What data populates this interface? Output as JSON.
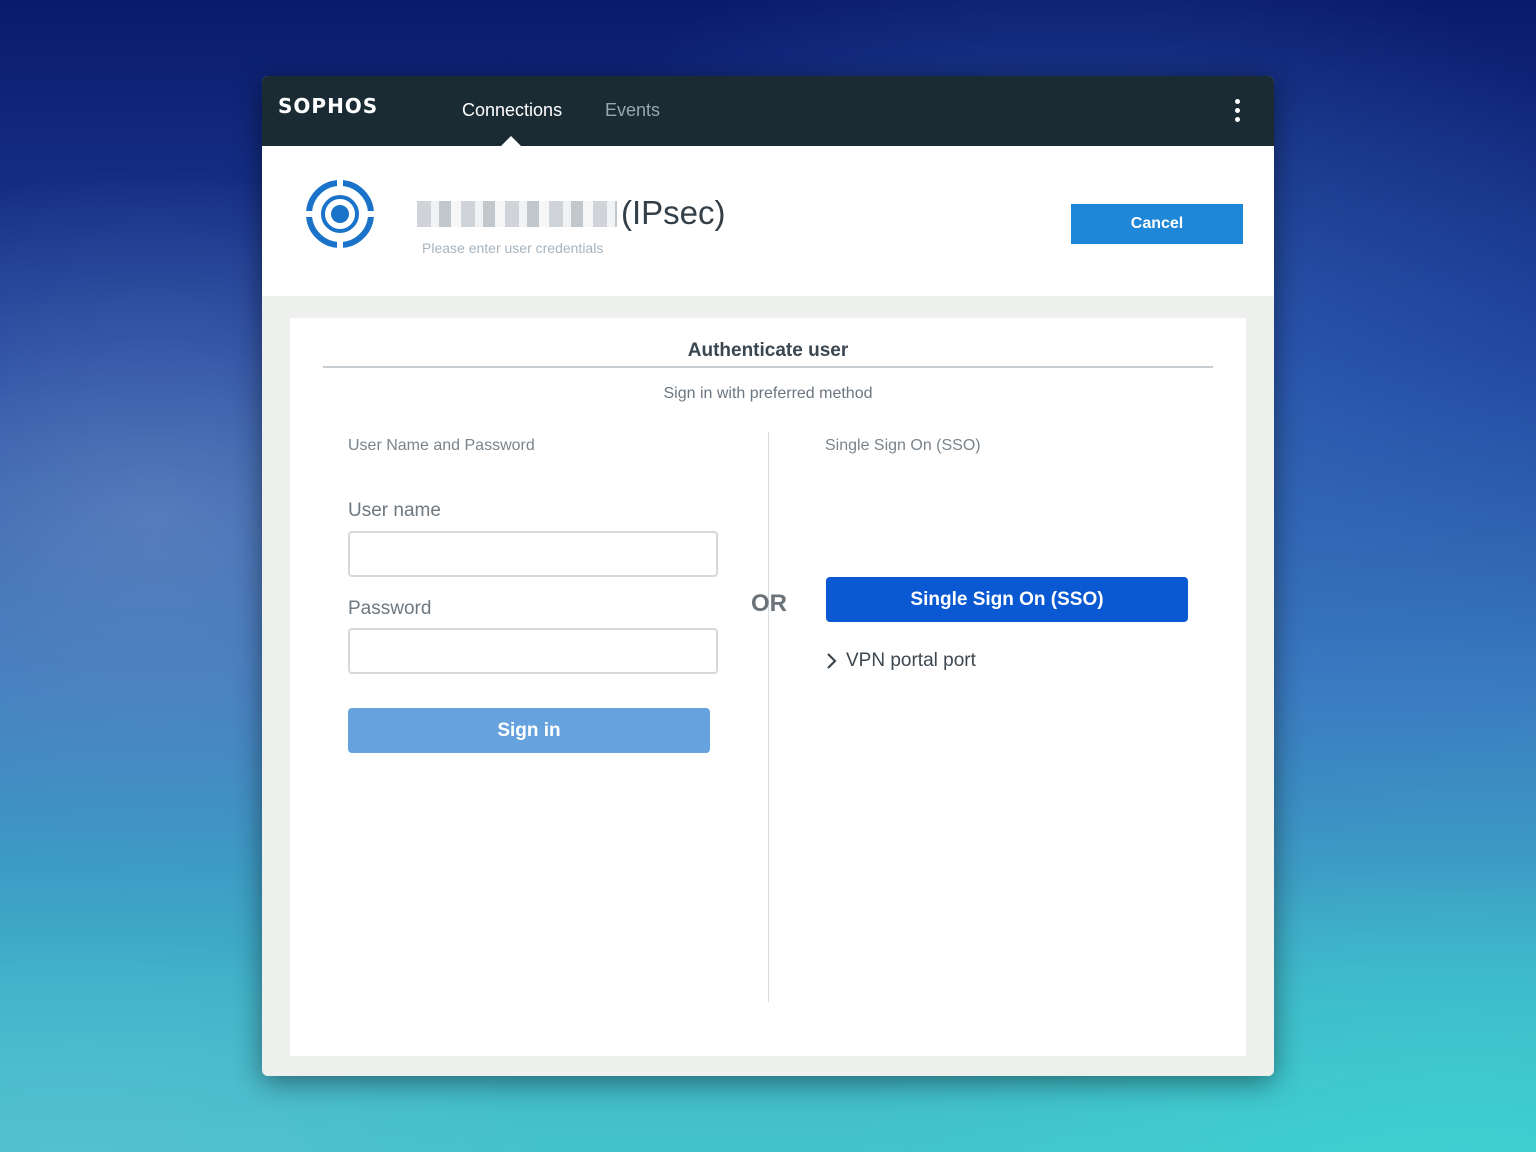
{
  "app": {
    "brand": "SOPHOS",
    "tabs": [
      {
        "label": "Connections",
        "active": true
      },
      {
        "label": "Events",
        "active": false
      }
    ],
    "menu_icon": "kebab-menu-icon"
  },
  "connection": {
    "icon": "connection-target-icon",
    "title_suffix": "(IPsec)",
    "subtitle": "Please enter user credentials",
    "cancel_label": "Cancel"
  },
  "auth": {
    "title": "Authenticate user",
    "subtitle": "Sign in with preferred method",
    "left": {
      "heading": "User Name and Password",
      "username_label": "User name",
      "username_value": "",
      "password_label": "Password",
      "password_value": "",
      "signin_label": "Sign in"
    },
    "or_label": "OR",
    "right": {
      "heading": "Single Sign On (SSO)",
      "sso_label": "Single Sign On (SSO)",
      "portal_link_label": "VPN portal port"
    }
  },
  "colors": {
    "topbar": "#1a2b33",
    "accent_blue": "#1f87d8",
    "sso_blue": "#0a59d2",
    "signin_disabled_blue": "#66a2dd"
  }
}
